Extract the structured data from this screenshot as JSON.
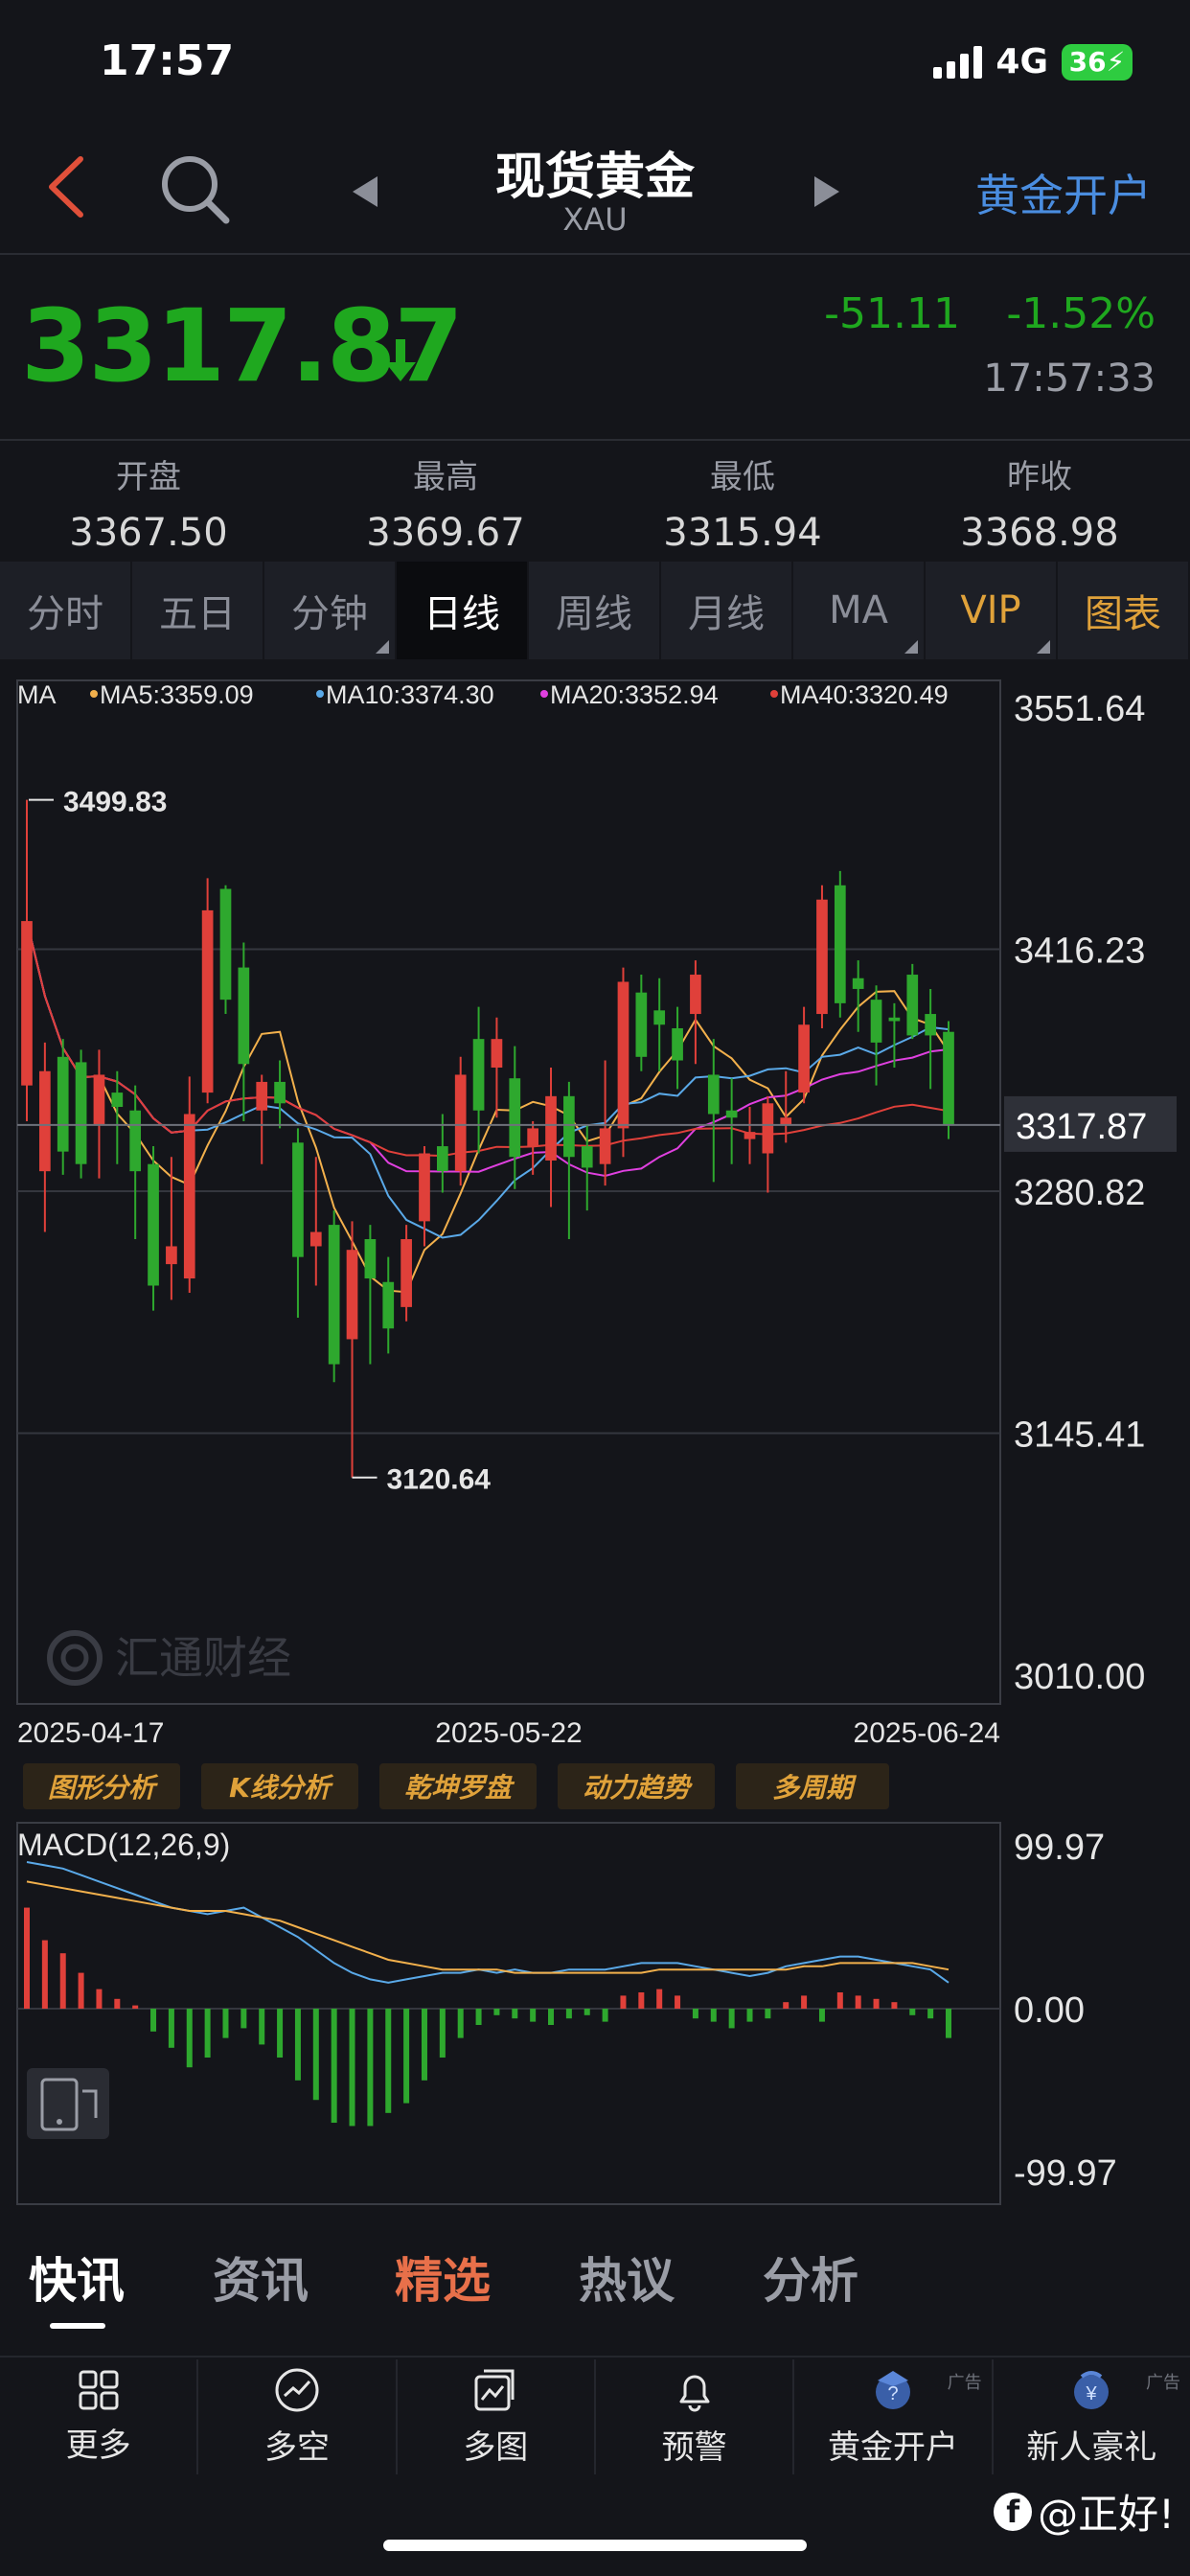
{
  "status": {
    "time": "17:57",
    "network": "4G",
    "battery": "36"
  },
  "nav": {
    "title": "现货黄金",
    "subtitle": "XAU",
    "open_account": "黄金开户"
  },
  "quote": {
    "price": "3317.87",
    "change": "-51.11",
    "change_pct": "-1.52%",
    "time": "17:57:33"
  },
  "ohlc": [
    {
      "label": "开盘",
      "value": "3367.50"
    },
    {
      "label": "最高",
      "value": "3369.67"
    },
    {
      "label": "最低",
      "value": "3315.94"
    },
    {
      "label": "昨收",
      "value": "3368.98"
    }
  ],
  "tabs": [
    "分时",
    "五日",
    "分钟",
    "日线",
    "周线",
    "月线",
    "MA",
    "VIP",
    "图表"
  ],
  "active_tab": "日线",
  "chart_data": [
    {
      "type": "candlestick",
      "legend": [
        "MA",
        "MA5:3359.09",
        "MA10:3374.30",
        "MA20:3352.94",
        "MA40:3320.49"
      ],
      "legend_colors": [
        "#ffffff",
        "#f2b04c",
        "#5aa9e8",
        "#e040e0",
        "#e0403a"
      ],
      "y_ticks": [
        "3551.64",
        "3416.23",
        "3280.82",
        "3145.41",
        "3010.00"
      ],
      "ylim": [
        3010.0,
        3551.64
      ],
      "current_price_label": "3317.87",
      "high_label": "3499.83",
      "low_label": "3120.64",
      "x_labels": [
        "2025-04-17",
        "2025-05-22",
        "2025-06-24"
      ],
      "candles": [
        [
          3340,
          3499.83,
          3320,
          3432
        ],
        [
          3292,
          3364,
          3258,
          3348
        ],
        [
          3356,
          3366,
          3290,
          3303
        ],
        [
          3353,
          3360,
          3288,
          3296
        ],
        [
          3318,
          3360,
          3288,
          3346
        ],
        [
          3336,
          3348,
          3296,
          3328
        ],
        [
          3326,
          3340,
          3254,
          3292
        ],
        [
          3296,
          3306,
          3214,
          3228
        ],
        [
          3240,
          3300,
          3220,
          3250
        ],
        [
          3232,
          3345,
          3224,
          3324
        ],
        [
          3336,
          3456,
          3330,
          3438
        ],
        [
          3450,
          3452,
          3380,
          3388
        ],
        [
          3406,
          3420,
          3320,
          3352
        ],
        [
          3326,
          3346,
          3296,
          3342
        ],
        [
          3342,
          3354,
          3316,
          3330
        ],
        [
          3308,
          3316,
          3210,
          3244
        ],
        [
          3250,
          3300,
          3228,
          3258
        ],
        [
          3262,
          3270,
          3174,
          3184
        ],
        [
          3198,
          3264,
          3120.64,
          3248
        ],
        [
          3254,
          3262,
          3184,
          3232
        ],
        [
          3230,
          3244,
          3190,
          3204
        ],
        [
          3216,
          3262,
          3208,
          3254
        ],
        [
          3264,
          3306,
          3250,
          3302
        ],
        [
          3306,
          3324,
          3280,
          3292
        ],
        [
          3292,
          3356,
          3284,
          3346
        ],
        [
          3366,
          3384,
          3302,
          3326
        ],
        [
          3350,
          3378,
          3322,
          3366
        ],
        [
          3344,
          3362,
          3282,
          3300
        ],
        [
          3306,
          3320,
          3290,
          3316
        ],
        [
          3298,
          3350,
          3272,
          3334
        ],
        [
          3334,
          3342,
          3254,
          3300
        ],
        [
          3306,
          3318,
          3270,
          3294
        ],
        [
          3296,
          3354,
          3284,
          3316
        ],
        [
          3316,
          3406,
          3300,
          3398
        ],
        [
          3392,
          3402,
          3348,
          3356
        ],
        [
          3382,
          3400,
          3348,
          3374
        ],
        [
          3372,
          3384,
          3338,
          3354
        ],
        [
          3380,
          3410,
          3352,
          3402
        ],
        [
          3346,
          3366,
          3286,
          3324
        ],
        [
          3326,
          3344,
          3296,
          3322
        ],
        [
          3310,
          3328,
          3296,
          3314
        ],
        [
          3302,
          3334,
          3280,
          3330
        ],
        [
          3318,
          3348,
          3308,
          3322
        ],
        [
          3336,
          3384,
          3330,
          3374
        ],
        [
          3380,
          3452,
          3372,
          3444
        ],
        [
          3452,
          3460,
          3378,
          3386
        ],
        [
          3400,
          3410,
          3370,
          3394
        ],
        [
          3388,
          3396,
          3340,
          3364
        ],
        [
          3378,
          3386,
          3350,
          3376
        ],
        [
          3402,
          3408,
          3366,
          3368
        ],
        [
          3380,
          3394,
          3338,
          3368
        ],
        [
          3370,
          3376,
          3310,
          3318
        ]
      ]
    },
    {
      "type": "macd",
      "title": "MACD(12,26,9)",
      "y_ticks": [
        "99.97",
        "0.00",
        "-99.97"
      ],
      "ylim": [
        -99.97,
        99.97
      ],
      "hist": [
        62,
        42,
        34,
        22,
        12,
        6,
        2,
        -14,
        -24,
        -36,
        -30,
        -18,
        -12,
        -22,
        -30,
        -44,
        -56,
        -70,
        -72,
        -72,
        -64,
        -58,
        -44,
        -30,
        -18,
        -10,
        -4,
        -6,
        -8,
        -10,
        -6,
        -4,
        -8,
        8,
        10,
        12,
        8,
        -6,
        -8,
        -12,
        -8,
        -6,
        4,
        8,
        -8,
        10,
        8,
        6,
        4,
        -4,
        -6,
        -18
      ],
      "dif": [
        90,
        88,
        86,
        82,
        78,
        74,
        70,
        66,
        62,
        60,
        58,
        60,
        62,
        56,
        50,
        44,
        36,
        28,
        22,
        18,
        16,
        18,
        20,
        22,
        22,
        24,
        22,
        24,
        22,
        22,
        24,
        24,
        24,
        26,
        28,
        28,
        28,
        26,
        24,
        22,
        20,
        22,
        26,
        28,
        30,
        32,
        32,
        30,
        28,
        26,
        24,
        16
      ],
      "dea": [
        78,
        76,
        74,
        72,
        70,
        68,
        66,
        64,
        62,
        60,
        60,
        60,
        58,
        56,
        54,
        50,
        46,
        42,
        38,
        34,
        30,
        28,
        26,
        24,
        24,
        24,
        24,
        22,
        22,
        22,
        22,
        22,
        22,
        22,
        22,
        24,
        24,
        24,
        24,
        24,
        24,
        24,
        24,
        26,
        26,
        28,
        28,
        28,
        28,
        28,
        26,
        24
      ]
    }
  ],
  "watermark_text": "汇通财经",
  "tools": [
    "图形分析",
    "K线分析",
    "乾坤罗盘",
    "动力趋势",
    "多周期"
  ],
  "news_tabs": [
    "快讯",
    "资讯",
    "精选",
    "热议",
    "分析"
  ],
  "bottom_bar": [
    {
      "label": "更多",
      "icon": "grid-icon",
      "ad": ""
    },
    {
      "label": "多空",
      "icon": "trend-circle-icon",
      "ad": ""
    },
    {
      "label": "多图",
      "icon": "multi-chart-icon",
      "ad": ""
    },
    {
      "label": "预警",
      "icon": "bell-icon",
      "ad": ""
    },
    {
      "label": "黄金开户",
      "icon": "gold-account-icon",
      "ad": "广告"
    },
    {
      "label": "新人豪礼",
      "icon": "gift-icon",
      "ad": "广告"
    }
  ],
  "footer_watermark": "@正好!"
}
